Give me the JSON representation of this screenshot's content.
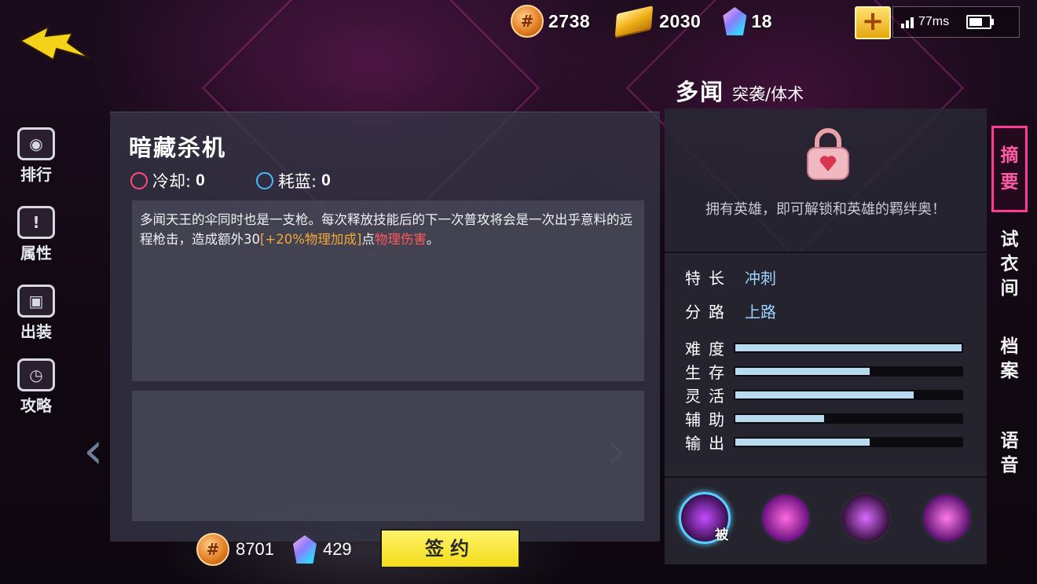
{
  "currency": {
    "coins": "2738",
    "gold": "2030",
    "gems": "18",
    "ping": "77ms",
    "coin_glyph": "#"
  },
  "left_nav": [
    {
      "label": "排行",
      "icon": "leaderboard-icon"
    },
    {
      "label": "属性",
      "icon": "attributes-icon"
    },
    {
      "label": "出装",
      "icon": "equipment-icon"
    },
    {
      "label": "攻略",
      "icon": "guide-icon"
    }
  ],
  "skill": {
    "title": "暗藏杀机",
    "cooldown_label": "冷却:",
    "cooldown_value": "0",
    "mana_label": "耗蓝:",
    "mana_value": "0",
    "desc_part1": "多闻天王的伞同时也是一支枪。每次释放技能后的下一次普攻将会是一次出乎意料的远程枪击，造成额外30",
    "desc_bonus": "[+20%物理加成]",
    "desc_part2": "点",
    "desc_damage": "物理伤害",
    "desc_end": "。"
  },
  "bottom": {
    "coins": "8701",
    "gems": "429",
    "sign_label": "签约"
  },
  "hero": {
    "name": "多闻",
    "role": "突袭/体术",
    "unlock_msg": "拥有英雄，即可解锁和英雄的羁绊奥！",
    "specialty_label": "特长",
    "specialty_value": "冲刺",
    "lane_label": "分路",
    "lane_value": "上路",
    "stats": [
      {
        "label": "难度",
        "value": 1.0
      },
      {
        "label": "生存",
        "value": 0.6
      },
      {
        "label": "灵活",
        "value": 0.79
      },
      {
        "label": "辅助",
        "value": 0.4
      },
      {
        "label": "输出",
        "value": 0.6
      }
    ],
    "skill_tag": "被"
  },
  "right_tabs": [
    "摘要",
    "试衣间",
    "档案",
    "语音"
  ],
  "colors": {
    "accent_pink": "#ff3c95",
    "stat_fill": "#b9dbef",
    "bonus": "#f3a73a",
    "damage": "#ff5a5a",
    "value_blue": "#9fd2ff"
  }
}
